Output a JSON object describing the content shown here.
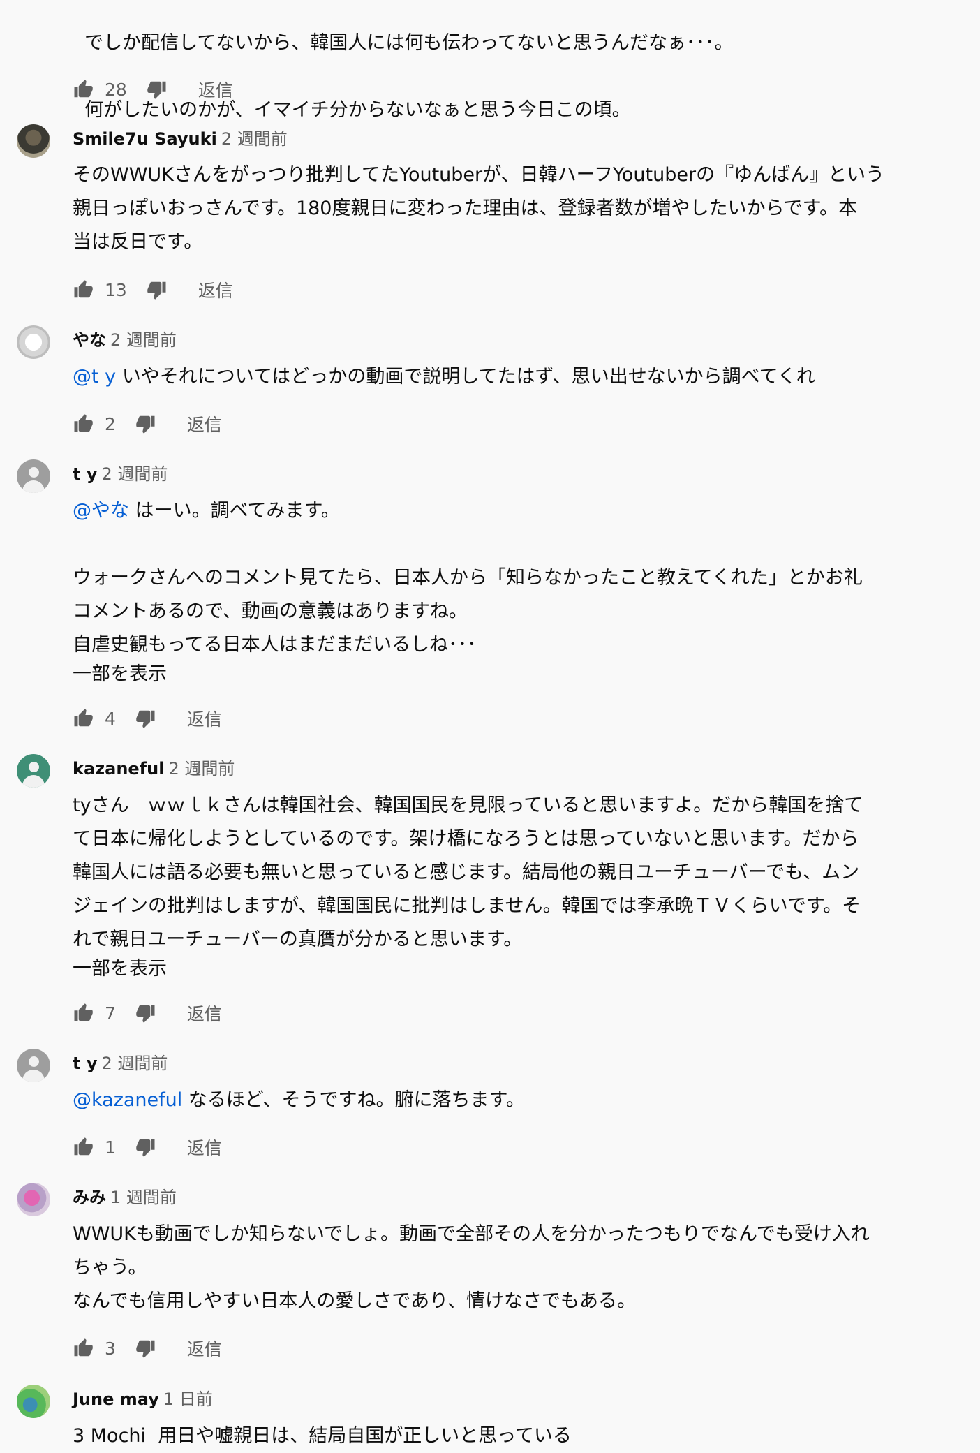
{
  "top_comment": {
    "lines": [
      "でしか配信してないから、韓国人には何も伝わってないと思うんだなぁ･･･。",
      "何がしたいのかが、イマイチ分からないなぁと思う今日この頃。"
    ],
    "likes": "28",
    "reply": "返信"
  },
  "comments": [
    {
      "author": "Smile7u Sayuki",
      "time": "2 週間前",
      "text": "そのWWUKさんをがっつり批判してたYoutuberが、日韓ハーフYoutuberの『ゆんばん』という\n親日っぽいおっさんです。180度親日に変わった理由は、登録者数が増やしたいからです。本\n当は反日です。",
      "likes": "13",
      "reply": "返信"
    },
    {
      "author": "やな",
      "time": "2 週間前",
      "mention": "@t y",
      "text": " いやそれについてはどっかの動画で説明してたはず、思い出せないから調べてくれ",
      "likes": "2",
      "reply": "返信"
    },
    {
      "author": "t y",
      "time": "2 週間前",
      "mention": "@やな",
      "text": " はーい。調べてみます。\n\nウォークさんへのコメント見てたら、日本人から「知らなかったこと教えてくれた」とかお礼\nコメントあるので、動画の意義はありますね。\n自虐史観もってる日本人はまだまだいるしね･･･",
      "more": "一部を表示",
      "likes": "4",
      "reply": "返信"
    },
    {
      "author": "kazaneful",
      "time": "2 週間前",
      "text": "tyさん　ｗｗｌｋさんは韓国社会、韓国国民を見限っていると思いますよ。だから韓国を捨て\nて日本に帰化しようとしているのです。架け橋になろうとは思っていないと思います。だから\n韓国人には語る必要も無いと思っていると感じます。結局他の親日ユーチューバーでも、ムン\nジェインの批判はしますが、韓国国民に批判はしません。韓国では李承晩ＴＶくらいです。そ\nれで親日ユーチューバーの真贋が分かると思います。",
      "more": "一部を表示",
      "likes": "7",
      "reply": "返信"
    },
    {
      "author": "t y",
      "time": "2 週間前",
      "mention": "@kazaneful",
      "text": " なるほど、そうですね。腑に落ちます。",
      "likes": "1",
      "reply": "返信"
    },
    {
      "author": "みみ",
      "time": "1 週間前",
      "text": "WWUKも動画でしか知らないでしょ。動画で全部その人を分かったつもりでなんでも受け入れ\nちゃう。\nなんでも信用しやすい日本人の愛しさであり、情けなさでもある。",
      "likes": "3",
      "reply": "返信"
    },
    {
      "author": "June may",
      "time": "1 日前",
      "text": "3 Mochi  用日や嘘親日は、結局自国が正しいと思っている"
    }
  ],
  "icons": {
    "like": "thumbs-up-icon",
    "dislike": "thumbs-down-icon"
  }
}
